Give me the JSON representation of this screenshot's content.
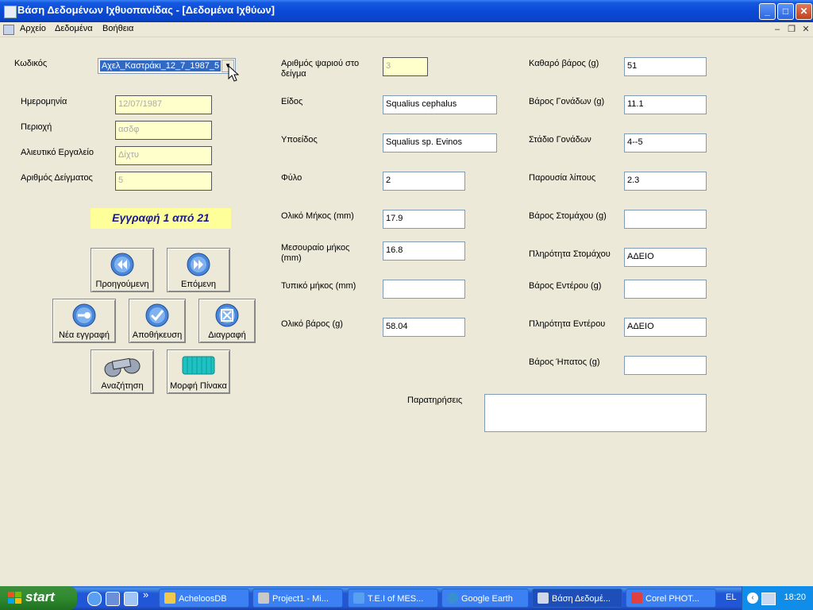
{
  "window": {
    "title": "Βάση Δεδομένων Ιχθυοπανίδας - [Δεδομένα Ιχθύων]",
    "min_label": "_",
    "max_label": "□",
    "close_label": "✕"
  },
  "menu": {
    "items": [
      "Αρχείο",
      "Δεδομένα",
      "Βοήθεια"
    ],
    "mdi_min": "–",
    "mdi_restore": "❐",
    "mdi_close": "✕"
  },
  "left": {
    "code_label": "Κωδικός",
    "code_value": "Αχελ_Καστράκι_12_7_1987_5",
    "date_label": "Ημερομηνία",
    "date_value": "12/07/1987",
    "area_label": "Περιοχή",
    "area_value": "ασδφ",
    "gear_label": "Αλιευτικό Εργαλείο",
    "gear_value": "Δίχτυ",
    "sample_no_label": "Αριθμός Δείγματος",
    "sample_no_value": "5",
    "record_text": "Εγγραφή 1 από  21"
  },
  "buttons": {
    "prev": "Προηγούμενη",
    "next": "Επόμενη",
    "new": "Νέα εγγραφή",
    "save": "Αποθήκευση",
    "delete": "Διαγραφή",
    "search": "Αναζήτηση",
    "table": "Μορφή Πίνακα"
  },
  "middle": {
    "fish_no_label": "Αριθμός ψαριού στο δείγμα",
    "fish_no_value": "3",
    "species_label": "Είδος",
    "species_value": "Squalius cephalus",
    "subspecies_label": "Υποείδος",
    "subspecies_value": "Squalius sp. Evinos",
    "sex_label": "Φύλο",
    "sex_value": "2",
    "total_length_label": "Ολικό Μήκος (mm)",
    "total_length_value": "17.9",
    "fork_length_label": "Μεσουραίο μήκος (mm)",
    "fork_length_value": "16.8",
    "standard_length_label": "Τυπικό μήκος (mm)",
    "standard_length_value": "",
    "total_weight_label": "Ολικό βάρος (g)",
    "total_weight_value": "58.04",
    "notes_label": "Παρατηρήσεις",
    "notes_value": ""
  },
  "right": {
    "net_weight_label": "Καθαρό βάρος (g)",
    "net_weight_value": "51",
    "gonad_weight_label": "Βάρος Γονάδων (g)",
    "gonad_weight_value": "11.1",
    "gonad_stage_label": "Στάδιο Γονάδων",
    "gonad_stage_value": "4--5",
    "fat_label": "Παρουσία λίπους",
    "fat_value": "2.3",
    "stomach_weight_label": "Βάρος Στομάχου (g)",
    "stomach_weight_value": "",
    "stomach_full_label": "Πληρότητα Στομάχου",
    "stomach_full_value": "ΑΔΕΙΟ",
    "intestine_weight_label": "Βάρος Εντέρου (g)",
    "intestine_weight_value": "",
    "intestine_full_label": "Πληρότητα Εντέρου",
    "intestine_full_value": "ΑΔΕΙΟ",
    "liver_weight_label": "Βάρος Ήπατος (g)",
    "liver_weight_value": ""
  },
  "taskbar": {
    "start": "start",
    "quick_more": "»",
    "tasks": [
      "AcheloosDB",
      "Project1 - Mi...",
      "T.E.I of MES...",
      "Google Earth",
      "Βάση Δεδομέ...",
      "Corel PHOT..."
    ],
    "lang": "EL",
    "clock": "18:20"
  },
  "colors": {
    "title_bar": "#0a4ad8",
    "window_bg": "#ece9d8",
    "readonly_field": "#ffffcc",
    "record_banner": "#ffff99",
    "record_text": "#1a1a8c",
    "taskbar": "#2157d7",
    "start_button": "#2f8a2f"
  }
}
